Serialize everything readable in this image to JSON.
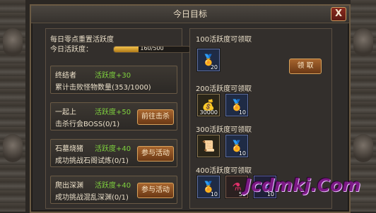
{
  "window": {
    "title": "今日目标"
  },
  "close": {
    "label": "X"
  },
  "activity": {
    "header": "每日零点重置活跃度",
    "progress_label": "今日活跃度：",
    "progress_text": "160/500",
    "progress_value": 0.32
  },
  "tasks": [
    {
      "name": "终结者",
      "reward": "活跃度+30",
      "desc": "累计击败怪物数量(353/1000)",
      "button": ""
    },
    {
      "name": "一起上",
      "reward": "活跃度+50",
      "desc": "击杀行会BOSS(0/1)",
      "button": "前往击杀"
    },
    {
      "name": "石墓烧猪",
      "reward": "活跃度+40",
      "desc": "成功挑战石阁试炼(0/1)",
      "button": "参与活动"
    },
    {
      "name": "爬出深渊",
      "reward": "活跃度+40",
      "desc": "成功挑战混乱深渊(0/1)",
      "button": "参与活动"
    }
  ],
  "rewards": [
    {
      "label": "100活跃度可领取",
      "button": "领 取",
      "items": [
        {
          "icon": "gold-token-icon",
          "qty": "20"
        }
      ]
    },
    {
      "label": "200活跃度可领取",
      "items": [
        {
          "icon": "gold-coins-icon",
          "qty": "30000"
        },
        {
          "icon": "gold-token-icon",
          "qty": "10"
        }
      ]
    },
    {
      "label": "300活跃度可领取",
      "items": [
        {
          "icon": "scroll-icon",
          "qty": ""
        },
        {
          "icon": "gold-token-icon",
          "qty": "10"
        }
      ]
    },
    {
      "label": "400活跃度可领取",
      "items": [
        {
          "icon": "gold-token-icon",
          "qty": "10"
        },
        {
          "icon": "red-potion-icon",
          "qty": "50"
        },
        {
          "icon": "blue-potion-icon",
          "qty": "10"
        }
      ]
    }
  ],
  "watermark": "Jcdmkj.Com"
}
